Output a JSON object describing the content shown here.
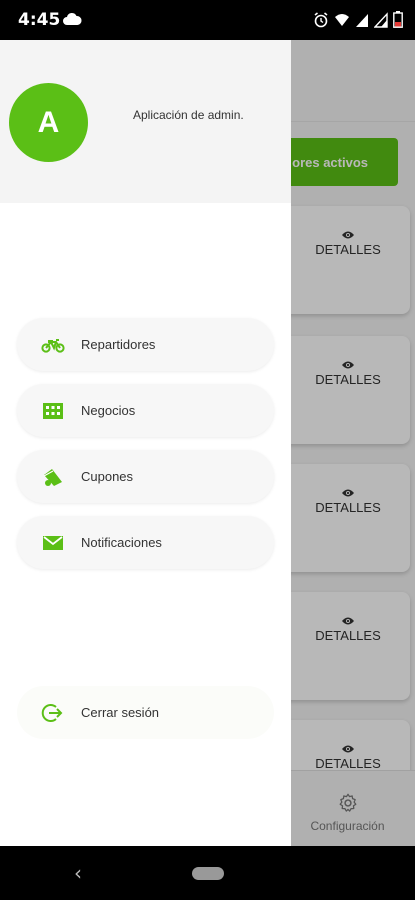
{
  "status_bar": {
    "time": "4:45",
    "icons": [
      "cloud-icon",
      "alarm-icon",
      "wifi-icon",
      "signal-icon",
      "signal-icon",
      "battery-icon"
    ]
  },
  "colors": {
    "accent": "#5bbf16",
    "drawer_bg": "#ffffff",
    "header_bg": "#f4f4f4"
  },
  "drawer": {
    "avatar_letter": "A",
    "app_title": "Aplicación de admin.",
    "items": [
      {
        "label": "Repartidores",
        "icon": "motorcycle-icon"
      },
      {
        "label": "Negocios",
        "icon": "building-icon"
      },
      {
        "label": "Cupones",
        "icon": "coupon-icon"
      },
      {
        "label": "Notificaciones",
        "icon": "mail-icon"
      }
    ],
    "logout": {
      "label": "Cerrar sesión",
      "icon": "logout-icon"
    }
  },
  "background": {
    "active_button": "ores activos",
    "card_action": "DETALLES",
    "bottom_nav": {
      "label": "Configuración",
      "icon": "gear-icon"
    }
  }
}
